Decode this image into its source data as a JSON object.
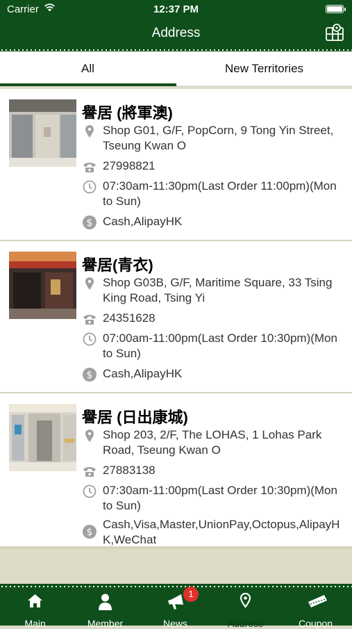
{
  "status": {
    "carrier": "Carrier",
    "time": "12:37 PM"
  },
  "navbar": {
    "title": "Address",
    "map_icon": "map-icon"
  },
  "tabs": [
    {
      "label": "All"
    },
    {
      "label": "New Territories"
    }
  ],
  "shops": [
    {
      "name": "譽居 (將軍澳)",
      "address": "Shop G01, G/F, PopCorn, 9 Tong Yin Street, Tseung Kwan O",
      "phone": "27998821",
      "hours": "07:30am-11:30pm(Last Order 11:00pm)(Mon to Sun)",
      "payment": "Cash,AlipayHK"
    },
    {
      "name": "譽居(青衣)",
      "address": "Shop G03B, G/F, Maritime Square, 33 Tsing King Road, Tsing Yi",
      "phone": "24351628",
      "hours": "07:00am-11:00pm(Last Order 10:30pm)(Mon to Sun)",
      "payment": "Cash,AlipayHK"
    },
    {
      "name": "譽居 (日出康城)",
      "address": "Shop 203, 2/F, The LOHAS, 1 Lohas Park Road, Tseung Kwan O",
      "phone": "27883138",
      "hours": "07:30am-11:00pm(Last Order 10:30pm)(Mon to Sun)",
      "payment": "Cash,Visa,Master,UnionPay,Octopus,AlipayHK,WeChat"
    }
  ],
  "tabbar": [
    {
      "label": "Main",
      "icon": "home-icon"
    },
    {
      "label": "Member",
      "icon": "person-icon"
    },
    {
      "label": "News",
      "icon": "megaphone-icon",
      "badge": "1"
    },
    {
      "label": "Address",
      "icon": "location-pin-icon"
    },
    {
      "label": "Coupon",
      "icon": "ticket-icon"
    }
  ],
  "colors": {
    "brand": "#0e4f1b",
    "background": "#dcdcc8",
    "badge": "#e0302a"
  }
}
